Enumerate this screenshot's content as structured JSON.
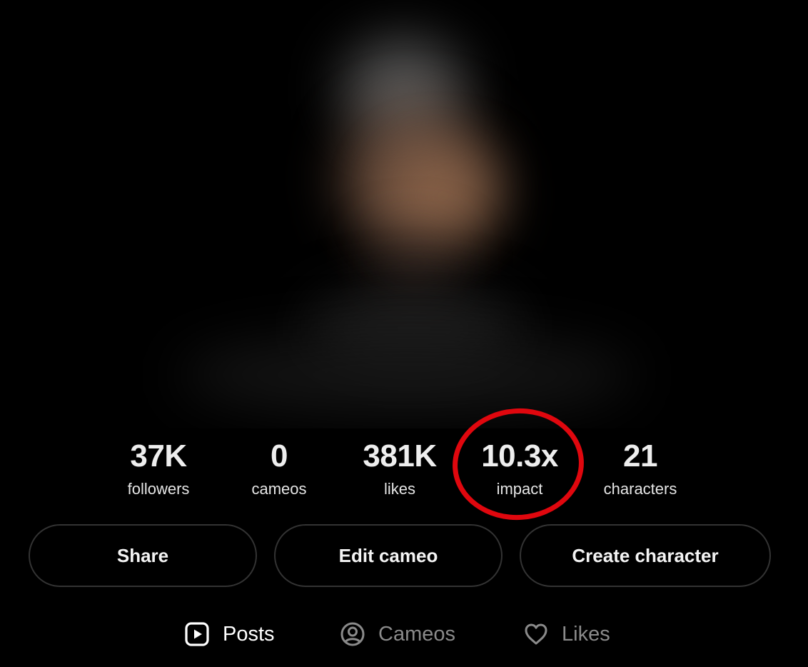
{
  "stats": [
    {
      "value": "37K",
      "label": "followers"
    },
    {
      "value": "0",
      "label": "cameos"
    },
    {
      "value": "381K",
      "label": "likes"
    },
    {
      "value": "10.3x",
      "label": "impact"
    },
    {
      "value": "21",
      "label": "characters"
    }
  ],
  "actions": {
    "share_label": "Share",
    "edit_label": "Edit cameo",
    "create_label": "Create character"
  },
  "tabs": [
    {
      "label": "Posts",
      "icon": "play-square-icon",
      "active": true
    },
    {
      "label": "Cameos",
      "icon": "user-circle-icon",
      "active": false
    },
    {
      "label": "Likes",
      "icon": "heart-icon",
      "active": false
    }
  ],
  "colors": {
    "background": "#000000",
    "highlight_ring": "#e0070e",
    "active_tab": "#ffffff",
    "inactive_tab": "#8a8a8a"
  }
}
